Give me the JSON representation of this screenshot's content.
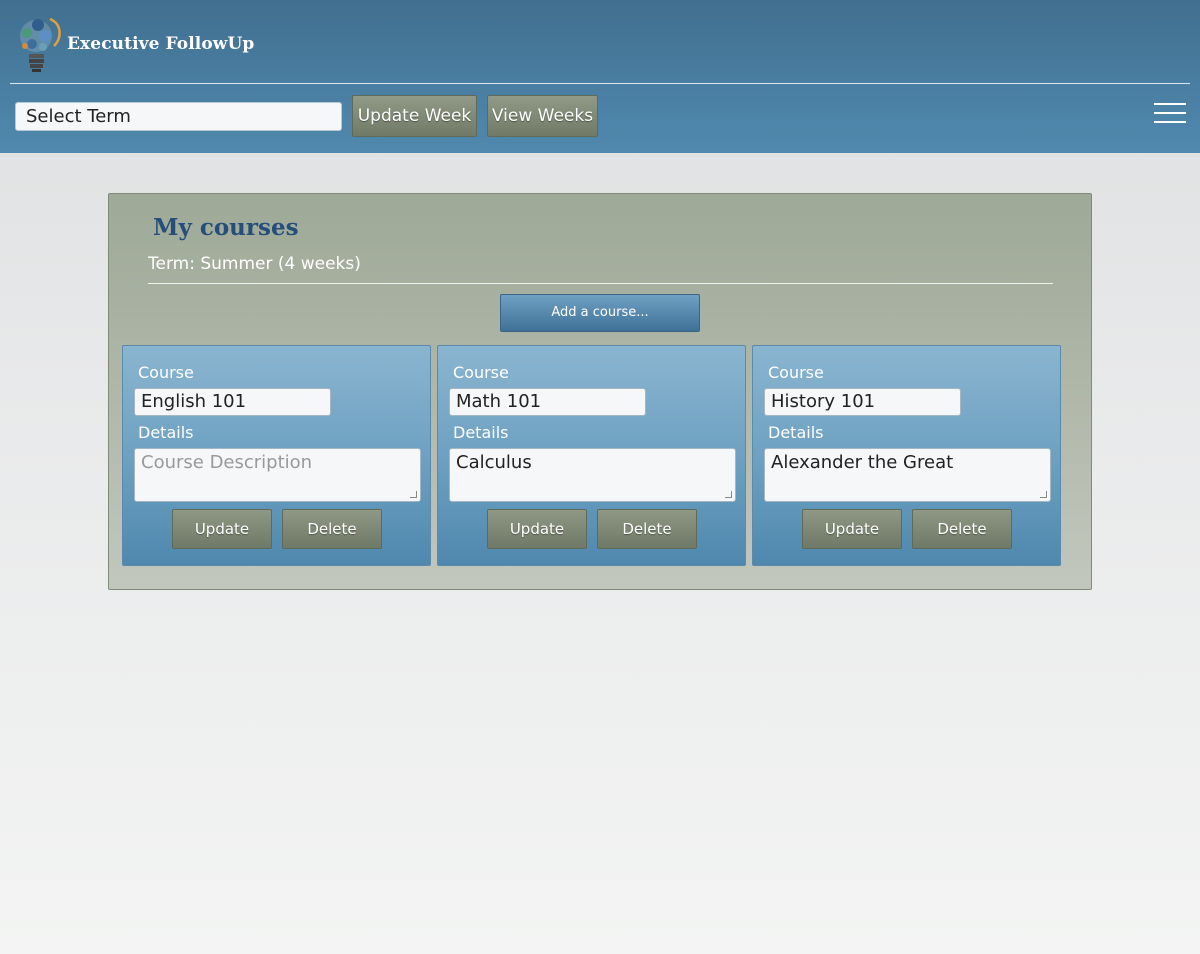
{
  "app": {
    "brand_name": "Executive FollowUp"
  },
  "toolbar": {
    "term_select_value": "Select Term",
    "update_week_label": "Update Week",
    "view_weeks_label": "View Weeks"
  },
  "main": {
    "title": "My courses",
    "term_text": "Term: Summer (4 weeks)",
    "add_course_label": "Add a course..."
  },
  "courses": [
    {
      "course_label": "Course",
      "course_value": "English 101",
      "details_label": "Details",
      "details_value": "",
      "details_placeholder": "Course Description",
      "update_label": "Update",
      "delete_label": "Delete"
    },
    {
      "course_label": "Course",
      "course_value": "Math 101",
      "details_label": "Details",
      "details_value": "Calculus",
      "details_placeholder": "Course Description",
      "update_label": "Update",
      "delete_label": "Delete"
    },
    {
      "course_label": "Course",
      "course_value": "History 101",
      "details_label": "Details",
      "details_value": "Alexander the Great",
      "details_placeholder": "Course Description",
      "update_label": "Update",
      "delete_label": "Delete"
    }
  ],
  "icons": {
    "logo": "lightbulb-gears-logo-icon",
    "menu": "hamburger-menu-icon"
  },
  "colors": {
    "header": "#4a7fa3",
    "panel": "#a9b1a1",
    "card": "#6b9fc0",
    "button_olive": "#7f8975",
    "title_blue": "#254f7a"
  }
}
